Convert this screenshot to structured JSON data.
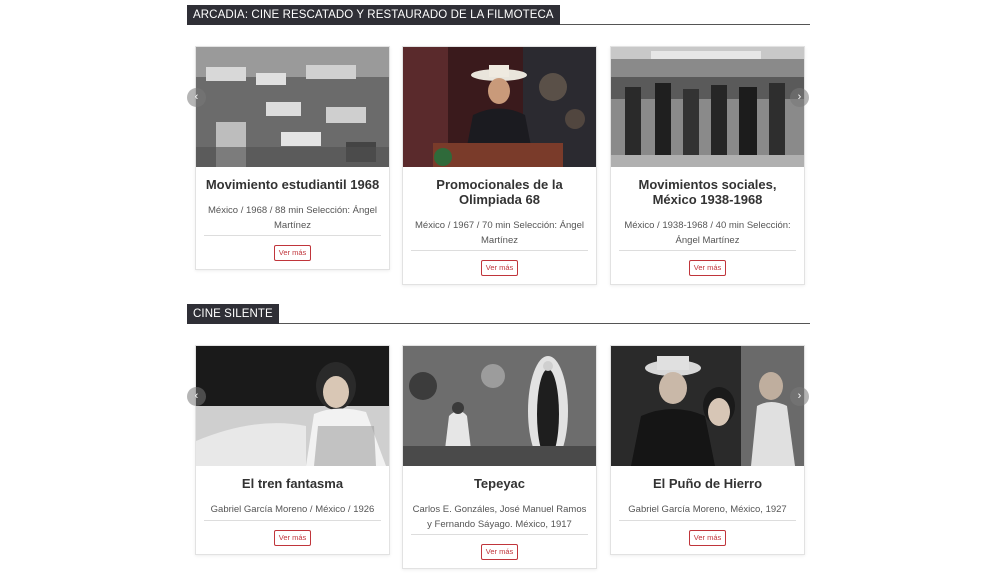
{
  "sections": [
    {
      "title": "ARCADIA: CINE RESCATADO Y RESTAURADO DE LA FILMOTECA",
      "cards": [
        {
          "title": "Movimiento estudiantil 1968",
          "meta": "México / 1968 / 88 min Selección: Ángel Martínez",
          "button": "Ver más"
        },
        {
          "title": "Promocionales de la Olimpiada 68",
          "meta": "México / 1967 / 70 min Selección: Ángel Martínez",
          "button": "Ver más"
        },
        {
          "title": "Movimientos sociales, México 1938-1968",
          "meta": "México / 1938-1968 / 40 min Selección: Ángel Martínez",
          "button": "Ver más"
        }
      ]
    },
    {
      "title": "CINE SILENTE",
      "cards": [
        {
          "title": "El tren fantasma",
          "meta": "Gabriel García Moreno / México / 1926",
          "button": "Ver más"
        },
        {
          "title": "Tepeyac",
          "meta": "Carlos E. Gonzáles, José Manuel Ramos y Fernando Sáyago. México, 1917",
          "button": "Ver más"
        },
        {
          "title": "El Puño de Hierro",
          "meta": "Gabriel García Moreno, México, 1927",
          "button": "Ver más"
        }
      ]
    }
  ],
  "icons": {
    "prev": "chevron-left-icon",
    "next": "chevron-right-icon"
  },
  "colors": {
    "header_bg": "#2f2f36",
    "button_accent": "#c0353b"
  }
}
